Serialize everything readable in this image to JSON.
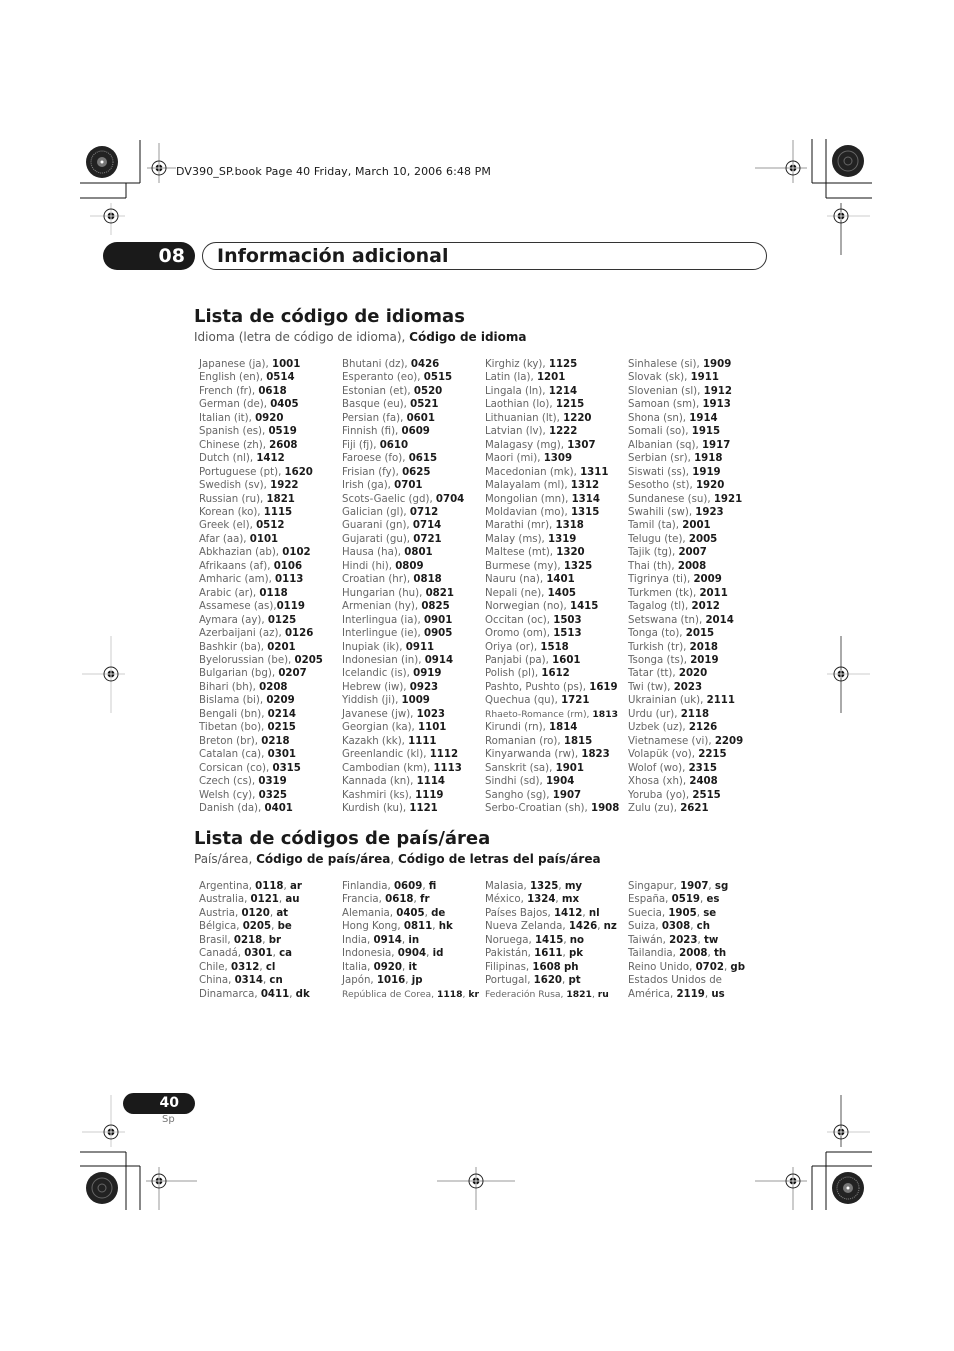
{
  "header": {
    "file_line": "DV390_SP.book  Page 40  Friday, March 10, 2006  6:48 PM"
  },
  "chapter": {
    "number": "08",
    "title": "Información adicional"
  },
  "languages": {
    "title": "Lista de código de idiomas",
    "subtitle_plain": "Idioma (letra de código de idioma), ",
    "subtitle_bold": "Código de idioma",
    "columns": [
      [
        {
          "name": "Japanese (ja), ",
          "code": "1001"
        },
        {
          "name": "English (en), ",
          "code": "0514"
        },
        {
          "name": "French (fr), ",
          "code": "0618"
        },
        {
          "name": "German (de), ",
          "code": "0405"
        },
        {
          "name": "Italian (it), ",
          "code": "0920"
        },
        {
          "name": "Spanish (es), ",
          "code": "0519"
        },
        {
          "name": "Chinese (zh), ",
          "code": "2608"
        },
        {
          "name": "Dutch (nl), ",
          "code": "1412"
        },
        {
          "name": "Portuguese (pt), ",
          "code": "1620"
        },
        {
          "name": "Swedish (sv), ",
          "code": "1922"
        },
        {
          "name": "Russian (ru), ",
          "code": "1821"
        },
        {
          "name": "Korean (ko), ",
          "code": "1115"
        },
        {
          "name": "Greek (el), ",
          "code": "0512"
        },
        {
          "name": "Afar (aa), ",
          "code": "0101"
        },
        {
          "name": "Abkhazian (ab), ",
          "code": "0102"
        },
        {
          "name": "Afrikaans (af), ",
          "code": "0106"
        },
        {
          "name": "Amharic (am), ",
          "code": "0113"
        },
        {
          "name": "Arabic (ar), ",
          "code": "0118"
        },
        {
          "name": "Assamese (as),",
          "code": "0119"
        },
        {
          "name": "Aymara (ay), ",
          "code": "0125"
        },
        {
          "name": "Azerbaijani (az), ",
          "code": "0126"
        },
        {
          "name": "Bashkir (ba), ",
          "code": "0201"
        },
        {
          "name": "Byelorussian (be), ",
          "code": "0205"
        },
        {
          "name": "Bulgarian (bg), ",
          "code": "0207"
        },
        {
          "name": "Bihari (bh), ",
          "code": "0208"
        },
        {
          "name": "Bislama (bi), ",
          "code": "0209"
        },
        {
          "name": "Bengali (bn), ",
          "code": "0214"
        },
        {
          "name": "Tibetan (bo), ",
          "code": "0215"
        },
        {
          "name": "Breton (br), ",
          "code": "0218"
        },
        {
          "name": "Catalan (ca), ",
          "code": "0301"
        },
        {
          "name": "Corsican (co), ",
          "code": "0315"
        },
        {
          "name": "Czech (cs), ",
          "code": "0319"
        },
        {
          "name": "Welsh (cy), ",
          "code": "0325"
        },
        {
          "name": "Danish (da), ",
          "code": "0401"
        }
      ],
      [
        {
          "name": "Bhutani (dz), ",
          "code": "0426"
        },
        {
          "name": "Esperanto (eo), ",
          "code": "0515"
        },
        {
          "name": "Estonian (et), ",
          "code": "0520"
        },
        {
          "name": "Basque (eu), ",
          "code": "0521"
        },
        {
          "name": "Persian (fa), ",
          "code": "0601"
        },
        {
          "name": "Finnish (fi), ",
          "code": "0609"
        },
        {
          "name": "Fiji (fj), ",
          "code": "0610"
        },
        {
          "name": "Faroese (fo), ",
          "code": "0615"
        },
        {
          "name": "Frisian (fy), ",
          "code": "0625"
        },
        {
          "name": "Irish (ga), ",
          "code": "0701"
        },
        {
          "name": "Scots-Gaelic (gd), ",
          "code": "0704"
        },
        {
          "name": "Galician (gl), ",
          "code": "0712"
        },
        {
          "name": "Guarani (gn), ",
          "code": "0714"
        },
        {
          "name": "Gujarati (gu), ",
          "code": "0721"
        },
        {
          "name": "Hausa (ha), ",
          "code": "0801"
        },
        {
          "name": "Hindi (hi), ",
          "code": "0809"
        },
        {
          "name": "Croatian (hr), ",
          "code": "0818"
        },
        {
          "name": "Hungarian (hu), ",
          "code": "0821"
        },
        {
          "name": "Armenian (hy), ",
          "code": "0825"
        },
        {
          "name": "Interlingua (ia), ",
          "code": "0901"
        },
        {
          "name": "Interlingue (ie), ",
          "code": "0905"
        },
        {
          "name": "Inupiak (ik), ",
          "code": "0911"
        },
        {
          "name": "Indonesian (in), ",
          "code": "0914"
        },
        {
          "name": "Icelandic (is), ",
          "code": "0919"
        },
        {
          "name": "Hebrew (iw), ",
          "code": "0923"
        },
        {
          "name": "Yiddish (ji), ",
          "code": "1009"
        },
        {
          "name": "Javanese (jw), ",
          "code": "1023"
        },
        {
          "name": "Georgian (ka), ",
          "code": "1101"
        },
        {
          "name": "Kazakh (kk), ",
          "code": "1111"
        },
        {
          "name": "Greenlandic (kl), ",
          "code": "1112"
        },
        {
          "name": "Cambodian (km), ",
          "code": "1113"
        },
        {
          "name": "Kannada (kn), ",
          "code": "1114"
        },
        {
          "name": "Kashmiri (ks), ",
          "code": "1119"
        },
        {
          "name": "Kurdish (ku), ",
          "code": "1121"
        }
      ],
      [
        {
          "name": "Kirghiz (ky), ",
          "code": "1125"
        },
        {
          "name": "Latin (la), ",
          "code": "1201"
        },
        {
          "name": "Lingala (ln), ",
          "code": "1214"
        },
        {
          "name": "Laothian (lo), ",
          "code": "1215"
        },
        {
          "name": "Lithuanian (lt), ",
          "code": "1220"
        },
        {
          "name": "Latvian (lv), ",
          "code": "1222"
        },
        {
          "name": "Malagasy (mg), ",
          "code": "1307"
        },
        {
          "name": "Maori (mi), ",
          "code": "1309"
        },
        {
          "name": "Macedonian (mk), ",
          "code": "1311"
        },
        {
          "name": "Malayalam (ml), ",
          "code": "1312"
        },
        {
          "name": "Mongolian (mn), ",
          "code": "1314"
        },
        {
          "name": "Moldavian (mo), ",
          "code": "1315"
        },
        {
          "name": "Marathi (mr), ",
          "code": "1318"
        },
        {
          "name": "Malay (ms), ",
          "code": "1319"
        },
        {
          "name": "Maltese (mt), ",
          "code": "1320"
        },
        {
          "name": "Burmese (my), ",
          "code": "1325"
        },
        {
          "name": "Nauru (na), ",
          "code": "1401"
        },
        {
          "name": "Nepali (ne), ",
          "code": "1405"
        },
        {
          "name": "Norwegian (no), ",
          "code": "1415"
        },
        {
          "name": "Occitan (oc), ",
          "code": "1503"
        },
        {
          "name": "Oromo (om), ",
          "code": "1513"
        },
        {
          "name": "Oriya (or), ",
          "code": "1518"
        },
        {
          "name": "Panjabi (pa), ",
          "code": "1601"
        },
        {
          "name": "Polish (pl), ",
          "code": "1612"
        },
        {
          "name": "Pashto, Pushto (ps), ",
          "code": "1619"
        },
        {
          "name": "Quechua (qu), ",
          "code": "1721"
        },
        {
          "name": "Rhaeto-Romance (rm), ",
          "code": "1813",
          "small": true
        },
        {
          "name": "Kirundi (rn), ",
          "code": "1814"
        },
        {
          "name": "Romanian (ro), ",
          "code": "1815"
        },
        {
          "name": "Kinyarwanda (rw), ",
          "code": "1823"
        },
        {
          "name": "Sanskrit (sa), ",
          "code": "1901"
        },
        {
          "name": "Sindhi (sd), ",
          "code": "1904"
        },
        {
          "name": "Sangho (sg), ",
          "code": "1907"
        },
        {
          "name": "Serbo-Croatian (sh), ",
          "code": "1908"
        }
      ],
      [
        {
          "name": "Sinhalese (si), ",
          "code": "1909"
        },
        {
          "name": "Slovak (sk), ",
          "code": "1911"
        },
        {
          "name": "Slovenian (sl), ",
          "code": "1912"
        },
        {
          "name": "Samoan (sm), ",
          "code": "1913"
        },
        {
          "name": "Shona (sn), ",
          "code": "1914"
        },
        {
          "name": "Somali (so), ",
          "code": "1915"
        },
        {
          "name": "Albanian (sq), ",
          "code": "1917"
        },
        {
          "name": "Serbian (sr), ",
          "code": "1918"
        },
        {
          "name": "Siswati (ss), ",
          "code": "1919"
        },
        {
          "name": "Sesotho (st), ",
          "code": "1920"
        },
        {
          "name": "Sundanese (su), ",
          "code": "1921"
        },
        {
          "name": "Swahili (sw), ",
          "code": "1923"
        },
        {
          "name": "Tamil (ta), ",
          "code": "2001"
        },
        {
          "name": "Telugu (te), ",
          "code": "2005"
        },
        {
          "name": "Tajik (tg), ",
          "code": "2007"
        },
        {
          "name": "Thai (th), ",
          "code": "2008"
        },
        {
          "name": "Tigrinya (ti), ",
          "code": "2009"
        },
        {
          "name": "Turkmen (tk), ",
          "code": "2011"
        },
        {
          "name": "Tagalog (tl), ",
          "code": "2012"
        },
        {
          "name": "Setswana (tn), ",
          "code": "2014"
        },
        {
          "name": "Tonga (to), ",
          "code": "2015"
        },
        {
          "name": "Turkish (tr), ",
          "code": "2018"
        },
        {
          "name": "Tsonga (ts), ",
          "code": "2019"
        },
        {
          "name": "Tatar (tt), ",
          "code": "2020"
        },
        {
          "name": "Twi (tw), ",
          "code": "2023"
        },
        {
          "name": "Ukrainian (uk), ",
          "code": "2111"
        },
        {
          "name": "Urdu (ur), ",
          "code": "2118"
        },
        {
          "name": "Uzbek (uz), ",
          "code": "2126"
        },
        {
          "name": "Vietnamese (vi), ",
          "code": "2209"
        },
        {
          "name": "Volapük (vo), ",
          "code": "2215"
        },
        {
          "name": "Wolof (wo), ",
          "code": "2315"
        },
        {
          "name": "Xhosa (xh), ",
          "code": "2408"
        },
        {
          "name": "Yoruba (yo), ",
          "code": "2515"
        },
        {
          "name": "Zulu (zu), ",
          "code": "2621"
        }
      ]
    ]
  },
  "countries": {
    "title": "Lista de códigos de país/área",
    "subtitle_plain": "País/área, ",
    "subtitle_bold1": "Código de país/área",
    "subtitle_sep": ", ",
    "subtitle_bold2": "Código de letras del país/área",
    "columns": [
      [
        {
          "name": "Argentina, ",
          "code": "0118",
          "sep": ", ",
          "letters": "ar"
        },
        {
          "name": "Australia, ",
          "code": "0121",
          "sep": ", ",
          "letters": "au"
        },
        {
          "name": "Austria, ",
          "code": "0120",
          "sep": ", ",
          "letters": "at"
        },
        {
          "name": "Bélgica, ",
          "code": "0205",
          "sep": ", ",
          "letters": "be"
        },
        {
          "name": "Brasil, ",
          "code": "0218",
          "sep": ", ",
          "letters": "br"
        },
        {
          "name": "Canadá, ",
          "code": "0301",
          "sep": ", ",
          "letters": "ca"
        },
        {
          "name": "Chile, ",
          "code": "0312",
          "sep": ", ",
          "letters": "cl"
        },
        {
          "name": "China, ",
          "code": "0314",
          "sep": ", ",
          "letters": "cn"
        },
        {
          "name": "Dinamarca, ",
          "code": "0411",
          "sep": ", ",
          "letters": "dk"
        }
      ],
      [
        {
          "name": "Finlandia, ",
          "code": "0609",
          "sep": ", ",
          "letters": "fi"
        },
        {
          "name": "Francia, ",
          "code": "0618",
          "sep": ", ",
          "letters": "fr"
        },
        {
          "name": "Alemania, ",
          "code": "0405",
          "sep": ", ",
          "letters": "de"
        },
        {
          "name": "Hong Kong, ",
          "code": "0811",
          "sep": ", ",
          "letters": "hk"
        },
        {
          "name": "India, ",
          "code": "0914",
          "sep": ", ",
          "letters": "in"
        },
        {
          "name": "Indonesia, ",
          "code": "0904",
          "sep": ", ",
          "letters": "id"
        },
        {
          "name": "Italia, ",
          "code": "0920",
          "sep": ", ",
          "letters": "it"
        },
        {
          "name": "Japón, ",
          "code": "1016",
          "sep": ", ",
          "letters": "jp"
        },
        {
          "name": "República de Corea, ",
          "code": "1118",
          "sep": ", ",
          "letters": "kr",
          "small": true
        }
      ],
      [
        {
          "name": "Malasia, ",
          "code": "1325",
          "sep": ", ",
          "letters": "my"
        },
        {
          "name": "México, ",
          "code": "1324",
          "sep": ", ",
          "letters": "mx"
        },
        {
          "name": "Países Bajos, ",
          "code": "1412",
          "sep": ", ",
          "letters": "nl"
        },
        {
          "name": "Nueva Zelanda, ",
          "code": "1426",
          "sep": ", ",
          "letters": "nz"
        },
        {
          "name": "Noruega, ",
          "code": "1415",
          "sep": ", ",
          "letters": "no"
        },
        {
          "name": "Pakistán, ",
          "code": "1611",
          "sep": ", ",
          "letters": "pk"
        },
        {
          "name": "Filipinas, ",
          "code": "1608",
          "sep": " ",
          "letters": "ph"
        },
        {
          "name": "Portugal, ",
          "code": "1620",
          "sep": ", ",
          "letters": "pt"
        },
        {
          "name": "Federación Rusa, ",
          "code": "1821",
          "sep": ", ",
          "letters": "ru",
          "small": true
        }
      ],
      [
        {
          "name": "Singapur, ",
          "code": "1907",
          "sep": ", ",
          "letters": "sg"
        },
        {
          "name": "España, ",
          "code": "0519",
          "sep": ", ",
          "letters": "es"
        },
        {
          "name": "Suecia, ",
          "code": "1905",
          "sep": ", ",
          "letters": "se"
        },
        {
          "name": "Suiza, ",
          "code": "0308",
          "sep": ", ",
          "letters": "ch"
        },
        {
          "name": "Taiwán, ",
          "code": "2023",
          "sep": ", ",
          "letters": "tw"
        },
        {
          "name": "Tailandia, ",
          "code": "2008",
          "sep": ", ",
          "letters": "th"
        },
        {
          "name": "Reino Unido, ",
          "code": "0702",
          "sep": ", ",
          "letters": "gb"
        },
        {
          "name": "Estados Unidos de",
          "code": "",
          "sep": "",
          "letters": ""
        },
        {
          "name": "América, ",
          "code": "2119",
          "sep": ", ",
          "letters": "us"
        }
      ]
    ]
  },
  "footer": {
    "page_number": "40",
    "language": "Sp"
  }
}
